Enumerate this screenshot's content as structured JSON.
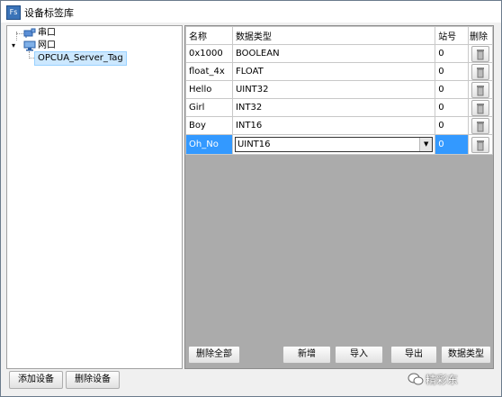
{
  "window": {
    "title": "设备标签库",
    "app_icon": "Fs"
  },
  "tree": {
    "serial": "串口",
    "network": "网口",
    "tag": "OPCUA_Server_Tag"
  },
  "grid": {
    "headers": {
      "name": "名称",
      "type": "数据类型",
      "station": "站号",
      "delete": "删除"
    },
    "rows": [
      {
        "name": "0x1000",
        "type": "BOOLEAN",
        "station": "0"
      },
      {
        "name": "float_4x",
        "type": "FLOAT",
        "station": "0"
      },
      {
        "name": "Hello",
        "type": "UINT32",
        "station": "0"
      },
      {
        "name": "Girl",
        "type": "INT32",
        "station": "0"
      },
      {
        "name": "Boy",
        "type": "INT16",
        "station": "0"
      },
      {
        "name": "Oh_No",
        "type": "UINT16",
        "station": "0"
      }
    ],
    "selected_row": 5
  },
  "buttons": {
    "delete_all": "删除全部",
    "add": "新增",
    "import": "导入",
    "export": "导出",
    "data_type": "数据类型",
    "add_device": "添加设备",
    "delete_device": "删除设备"
  },
  "watermark": "精彩东",
  "icons": {
    "delete": "trash-icon",
    "dropdown": "chevron-down-icon"
  },
  "colors": {
    "selection": "#3399ff",
    "tree_selection": "#cce8ff"
  }
}
